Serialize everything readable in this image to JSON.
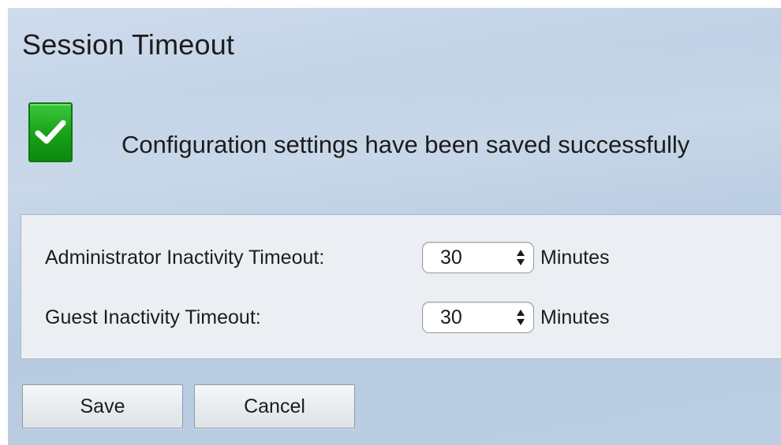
{
  "page": {
    "title": "Session Timeout"
  },
  "status": {
    "icon": "checkmark-icon",
    "message": "Configuration settings have been saved successfully"
  },
  "settings": {
    "admin_timeout": {
      "label": "Administrator Inactivity Timeout:",
      "value": "30",
      "unit": "Minutes"
    },
    "guest_timeout": {
      "label": "Guest Inactivity Timeout:",
      "value": "30",
      "unit": "Minutes"
    }
  },
  "actions": {
    "save_label": "Save",
    "cancel_label": "Cancel"
  },
  "colors": {
    "success_green": "#1aa11a",
    "background_blue": "#bccfe4",
    "panel_bg": "#ebeff4"
  }
}
